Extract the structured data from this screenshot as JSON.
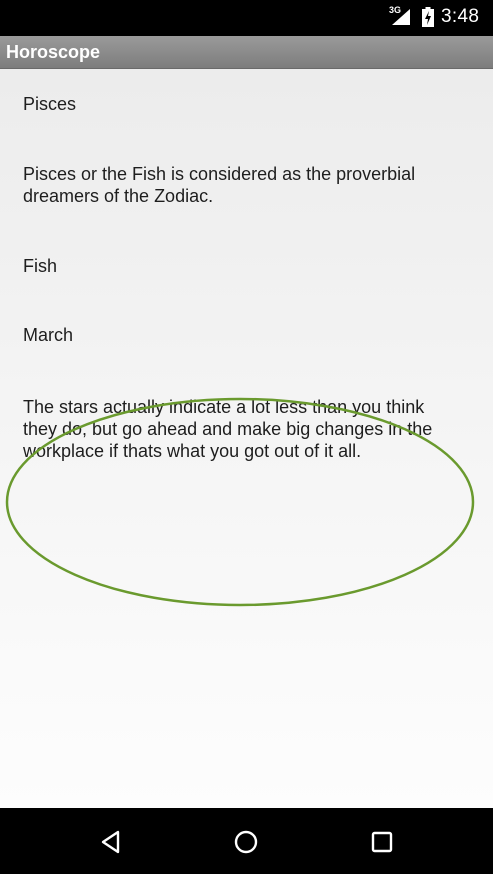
{
  "status_bar": {
    "network_type": "3G",
    "time": "3:48",
    "icons": [
      "signal-icon",
      "battery-charging-icon"
    ]
  },
  "action_bar": {
    "title": "Horoscope"
  },
  "horoscope": {
    "sign": "Pisces",
    "description": "Pisces or the Fish is considered as the proverbial dreamers of the Zodiac.",
    "symbol": "Fish",
    "month": "March",
    "prediction": "The stars actually indicate a lot less than you think they do, but go ahead and make big changes in the workplace if thats what you got out of it all."
  },
  "annotation": {
    "highlight_color": "#6a9a2e"
  },
  "nav_bar": {
    "icons": [
      "back-icon",
      "home-icon",
      "recents-icon"
    ]
  }
}
